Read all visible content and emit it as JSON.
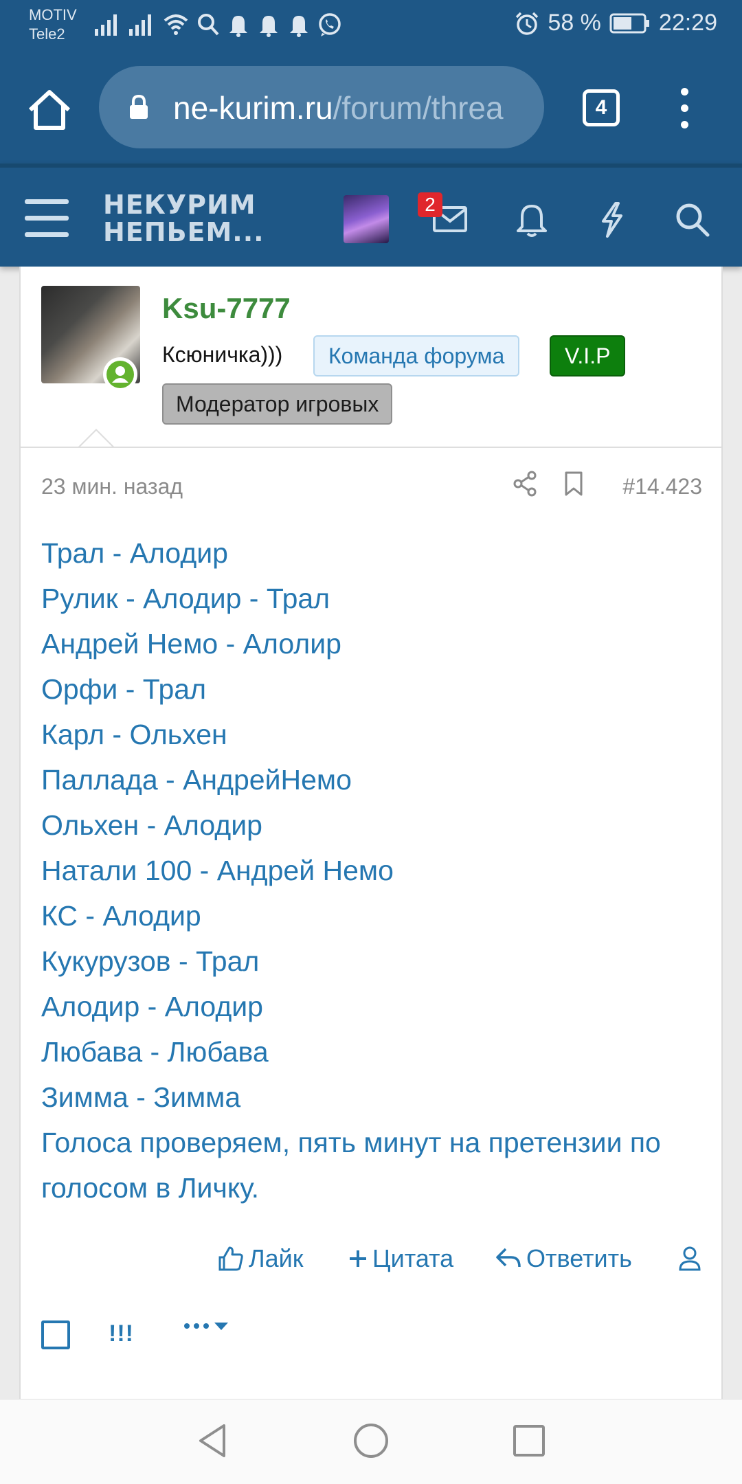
{
  "status_bar": {
    "carrier_1": "MOTIV",
    "carrier_2": "Tele2",
    "battery_percent": "58 %",
    "time": "22:29",
    "icons": [
      "signal-icon",
      "signal-icon",
      "wifi-icon",
      "search-icon",
      "notification-bell-icon",
      "notification-bell-icon",
      "notification-bell-icon",
      "whatsapp-icon",
      "alarm-icon",
      "battery-icon"
    ]
  },
  "browser": {
    "url_host": "ne-kurim.ru",
    "url_path": "/forum/threa",
    "tab_count": "4"
  },
  "forum_header": {
    "logo_line_1": "НЕКУРИМ",
    "logo_line_2": "НЕПЬЕМ...",
    "messages_badge": "2"
  },
  "post": {
    "username": "Ksu-7777",
    "user_title": "Ксюничка)))",
    "tag_team": "Команда форума",
    "tag_vip": "V.I.P",
    "tag_moder": "Модератор игровых",
    "time": "23 мин. назад",
    "number": "#14.423",
    "lines": [
      "Трал - Алодир",
      "Рулик - Алодир - Трал",
      "Андрей Немо - Алолир",
      "Орфи - Трал",
      "Карл - Ольхен",
      "Паллада - АндрейНемо",
      "Ольхен - Алодир",
      "Натали 100 - Андрей Немо",
      "КС - Алодир",
      "Кукурузов - Трал",
      "Алодир - Алодир",
      "Любава - Любава",
      "Зимма - Зимма"
    ],
    "closing_text": "Голоса проверяем, пять минут на претензии по голосом в Личку.",
    "actions": {
      "like": "Лайк",
      "quote": "Цитата",
      "reply": "Ответить"
    },
    "excl": "!!!"
  },
  "colors": {
    "header_bg": "#1e5786",
    "link_blue": "#2577b1",
    "username_green": "#3d8b3d",
    "vip_green": "#0d7f0d",
    "badge_red": "#e0262c"
  }
}
